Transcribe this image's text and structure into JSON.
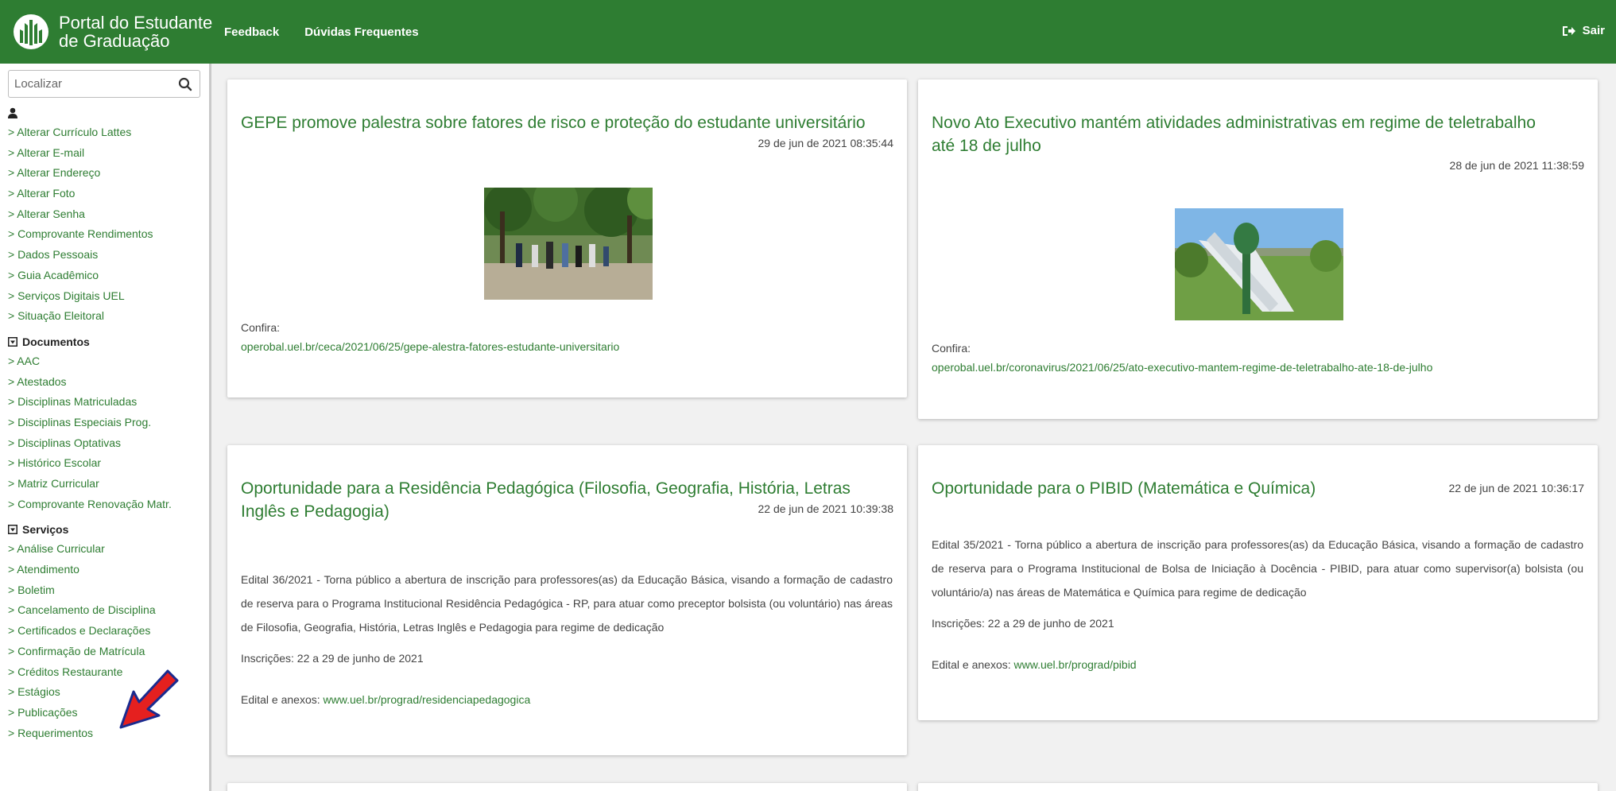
{
  "header": {
    "brand_line1": "Portal do Estudante",
    "brand_line2": "de Graduação",
    "nav": [
      "Feedback",
      "Dúvidas Frequentes"
    ],
    "logout": "Sair",
    "color": "#2e7d32"
  },
  "sidebar": {
    "search_placeholder": "Localizar",
    "profile_items": [
      "Alterar Currículo Lattes",
      "Alterar E-mail",
      "Alterar Endereço",
      "Alterar Foto",
      "Alterar Senha",
      "Comprovante Rendimentos",
      "Dados Pessoais",
      "Guia Acadêmico",
      "Serviços Digitais UEL",
      "Situação Eleitoral"
    ],
    "documents_title": "Documentos",
    "documents_items": [
      "AAC",
      "Atestados",
      "Disciplinas Matriculadas",
      "Disciplinas Especiais Prog.",
      "Disciplinas Optativas",
      "Histórico Escolar",
      "Matriz Curricular",
      "Comprovante Renovação Matr."
    ],
    "services_title": "Serviços",
    "services_items": [
      "Análise Curricular",
      "Atendimento",
      "Boletim",
      "Cancelamento de Disciplina",
      "Certificados e Declarações",
      "Confirmação de Matrícula",
      "Créditos Restaurante",
      "Estágios",
      "Publicações",
      "Requerimentos"
    ],
    "item_prefix": "> "
  },
  "cards": [
    {
      "title": "GEPE promove palestra sobre fatores de risco e proteção do estudante universitário",
      "date": "29 de jun de 2021 08:35:44",
      "label": "Confira:",
      "link": "operobal.uel.br/ceca/2021/06/25/gepe-alestra-fatores-estudante-universitario"
    },
    {
      "title": "Novo Ato Executivo mantém atividades administrativas em regime de teletrabalho até 18 de julho",
      "date": "28 de jun de 2021 11:38:59",
      "label": "Confira:",
      "link": "operobal.uel.br/coronavirus/2021/06/25/ato-executivo-mantem-regime-de-teletrabalho-ate-18-de-julho"
    },
    {
      "title": "Oportunidade para a Residência Pedagógica (Filosofia, Geografia, História, Letras Inglês e Pedagogia)",
      "date": "22 de jun de 2021 10:39:38",
      "body": "Edital 36/2021 - Torna público a abertura de inscrição para professores(as) da Educação Básica, visando a formação de cadastro de reserva para o Programa Institucional Residência Pedagógica - RP, para atuar como preceptor bolsista (ou voluntário) nas áreas de Filosofia, Geografia, História, Letras Inglês e Pedagogia para regime de dedicação",
      "inscricoes": "Inscrições: 22 a 29 de junho de 2021",
      "edital_label": "Edital e anexos: ",
      "edital_link": "www.uel.br/prograd/residenciapedagogica"
    },
    {
      "title": "Oportunidade para o PIBID (Matemática e Química)",
      "date": "22 de jun de 2021 10:36:17",
      "body": "Edital 35/2021 - Torna público a abertura de inscrição para professores(as) da Educação Básica, visando a formação de cadastro de reserva para o Programa Institucional de Bolsa de Iniciação à Docência - PIBID, para atuar como supervisor(a) bolsista (ou voluntário/a) nas áreas de Matemática e Química para regime de dedicação",
      "inscricoes": "Inscrições: 22 a 29 de junho de 2021",
      "edital_label": "Edital e anexos: ",
      "edital_link": "www.uel.br/prograd/pibid"
    }
  ]
}
